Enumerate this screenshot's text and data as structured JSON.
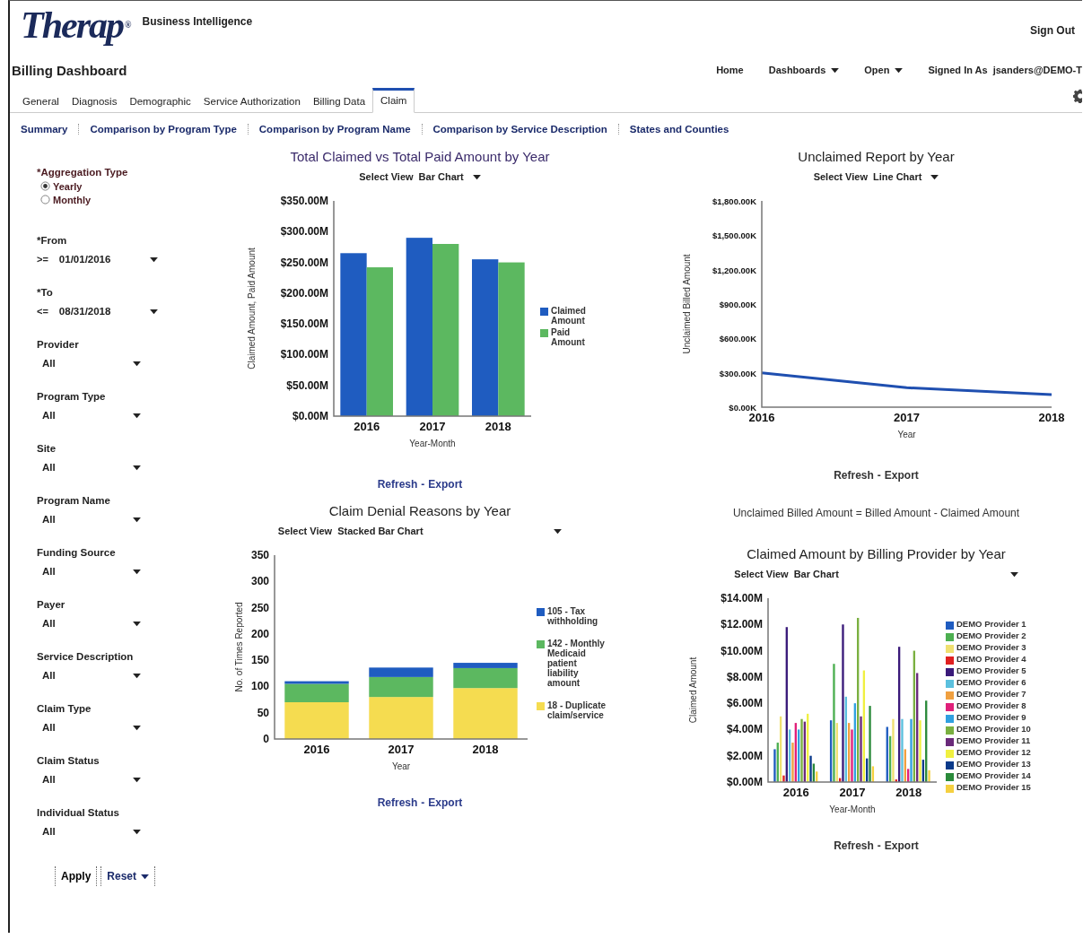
{
  "header": {
    "logo": "Therap",
    "logo_mark": "®",
    "product": "Business Intelligence",
    "sign_out": "Sign Out"
  },
  "title_bar": {
    "title": "Billing Dashboard",
    "nav": [
      {
        "label": "Home",
        "dropdown": false
      },
      {
        "label": "Dashboards",
        "dropdown": true
      },
      {
        "label": "Open",
        "dropdown": true
      }
    ],
    "signed_in_label": "Signed In As",
    "user": "jsanders@DEMO-T"
  },
  "tabs": [
    {
      "label": "General",
      "selected": false
    },
    {
      "label": "Diagnosis",
      "selected": false
    },
    {
      "label": "Demographic",
      "selected": false
    },
    {
      "label": "Service Authorization",
      "selected": false
    },
    {
      "label": "Billing Data",
      "selected": false
    },
    {
      "label": "Claim",
      "selected": true
    }
  ],
  "subtabs": [
    "Summary",
    "Comparison by Program Type",
    "Comparison by Program Name",
    "Comparison by Service Description",
    "States and Counties"
  ],
  "filters": {
    "required_mark": "*",
    "aggregation": {
      "label": "Aggregation Type",
      "required": true,
      "options": [
        {
          "label": "Yearly",
          "selected": true
        },
        {
          "label": "Monthly",
          "selected": false
        }
      ]
    },
    "fields": [
      {
        "label": "From",
        "required": true,
        "operator": ">=",
        "value": "01/01/2016"
      },
      {
        "label": "To",
        "required": true,
        "operator": "<=",
        "value": "08/31/2018"
      },
      {
        "label": "Provider",
        "required": false,
        "value": "All"
      },
      {
        "label": "Program Type",
        "required": false,
        "value": "All"
      },
      {
        "label": "Site",
        "required": false,
        "value": "All"
      },
      {
        "label": "Program Name",
        "required": false,
        "value": "All"
      },
      {
        "label": "Funding Source",
        "required": false,
        "value": "All"
      },
      {
        "label": "Payer",
        "required": false,
        "value": "All"
      },
      {
        "label": "Service Description",
        "required": false,
        "value": "All"
      },
      {
        "label": "Claim Type",
        "required": false,
        "value": "All"
      },
      {
        "label": "Claim Status",
        "required": false,
        "value": "All"
      },
      {
        "label": "Individual Status",
        "required": false,
        "value": "All"
      }
    ],
    "apply": "Apply",
    "reset": "Reset"
  },
  "charts": [
    {
      "title": "Total Claimed vs Total Paid Amount by Year",
      "view_label": "Select View",
      "view": "Bar Chart",
      "links": [
        "Refresh",
        "Export"
      ],
      "link_separator": "-",
      "chart_data": {
        "type": "bar",
        "legend": "right",
        "xlabel": "Year-Month",
        "ylabel": "Claimed Amount, Paid Amount",
        "categories": [
          "2016",
          "2017",
          "2018"
        ],
        "series": [
          {
            "name": "Claimed Amount",
            "color": "#1f5cc0",
            "values": [
              265,
              290,
              255
            ]
          },
          {
            "name": "Paid Amount",
            "color": "#5cb860",
            "values": [
              242,
              280,
              250
            ]
          }
        ],
        "ylim": [
          0,
          350
        ],
        "yticks": [
          {
            "value": 0,
            "label": "$0.00M"
          },
          {
            "value": 50,
            "label": "$50.00M"
          },
          {
            "value": 100,
            "label": "$100.00M"
          },
          {
            "value": 150,
            "label": "$150.00M"
          },
          {
            "value": 200,
            "label": "$200.00M"
          },
          {
            "value": 250,
            "label": "$250.00M"
          },
          {
            "value": 300,
            "label": "$300.00M"
          },
          {
            "value": 350,
            "label": "$350.00M"
          }
        ]
      }
    },
    {
      "title": "Unclaimed Report by Year",
      "view_label": "Select View",
      "view": "Line Chart",
      "links": [
        "Refresh",
        "Export"
      ],
      "link_separator": "-",
      "note": "Unclaimed Billed Amount = Billed Amount - Claimed Amount",
      "chart_data": {
        "type": "line",
        "xlabel": "Year",
        "ylabel": "Unclaimed Billed Amount",
        "categories": [
          "2016",
          "2017",
          "2018"
        ],
        "series": [
          {
            "color": "#1f4fb0",
            "values": [
              300,
              170,
              110
            ]
          }
        ],
        "ylim": [
          0,
          1800
        ],
        "yticks": [
          {
            "value": 0,
            "label": "$0.00K"
          },
          {
            "value": 300,
            "label": "$300.00K"
          },
          {
            "value": 600,
            "label": "$600.00K"
          },
          {
            "value": 900,
            "label": "$900.00K"
          },
          {
            "value": 1200,
            "label": "$1,200.00K"
          },
          {
            "value": 1500,
            "label": "$1,500.00K"
          },
          {
            "value": 1800,
            "label": "$1,800.00K"
          }
        ]
      }
    },
    {
      "title": "Claim Denial Reasons by Year",
      "view_label": "Select View",
      "view": "Stacked Bar Chart",
      "links": [
        "Refresh",
        "Export"
      ],
      "link_separator": "-",
      "chart_data": {
        "type": "bar",
        "legend": "right",
        "stacked": true,
        "xlabel": "Year",
        "ylabel": "No. of Times Reported",
        "categories": [
          "2016",
          "2017",
          "2018"
        ],
        "series": [
          {
            "name": "105 - Tax withholding",
            "color": "#1f5cc0",
            "values": [
              5,
              18,
              10
            ]
          },
          {
            "name": "142 - Monthly Medicaid patient liability amount",
            "color": "#5cb860",
            "values": [
              35,
              38,
              38
            ]
          },
          {
            "name": "18 - Duplicate claim/service",
            "color": "#f5dc50",
            "values": [
              70,
              80,
              97
            ]
          }
        ],
        "ylim": [
          0,
          350
        ],
        "yticks": [
          0,
          50,
          100,
          150,
          200,
          250,
          300,
          350
        ]
      }
    },
    {
      "title": "Claimed Amount by Billing Provider by Year",
      "view_label": "Select View",
      "view": "Bar Chart",
      "links": [
        "Refresh",
        "Export"
      ],
      "link_separator": "-",
      "chart_data": {
        "type": "bar",
        "legend": "right",
        "xlabel": "Year-Month",
        "ylabel": "Claimed Amount",
        "categories": [
          "2016",
          "2017",
          "2018"
        ],
        "series": [
          {
            "name": "DEMO Provider 1",
            "color": "#1f5cc0",
            "values": [
              2.5,
              4.7,
              4.2
            ]
          },
          {
            "name": "DEMO Provider 2",
            "color": "#4caf50",
            "values": [
              3.0,
              9.0,
              3.5
            ]
          },
          {
            "name": "DEMO Provider 3",
            "color": "#f0e070",
            "values": [
              5.0,
              4.5,
              4.8
            ]
          },
          {
            "name": "DEMO Provider 4",
            "color": "#e02020",
            "values": [
              0.5,
              0.3,
              0.2
            ]
          },
          {
            "name": "DEMO Provider 5",
            "color": "#3a1a7a",
            "values": [
              11.8,
              12.0,
              10.3
            ]
          },
          {
            "name": "DEMO Provider 6",
            "color": "#5bc0de",
            "values": [
              4.0,
              6.5,
              4.8
            ]
          },
          {
            "name": "DEMO Provider 7",
            "color": "#f0a040",
            "values": [
              3.0,
              4.5,
              2.5
            ]
          },
          {
            "name": "DEMO Provider 8",
            "color": "#e0207a",
            "values": [
              4.5,
              4.0,
              1.0
            ]
          },
          {
            "name": "DEMO Provider 9",
            "color": "#30a0e0",
            "values": [
              4.0,
              6.0,
              4.8
            ]
          },
          {
            "name": "DEMO Provider 10",
            "color": "#7ab040",
            "values": [
              4.8,
              12.5,
              10.0
            ]
          },
          {
            "name": "DEMO Provider 11",
            "color": "#6a2a7a",
            "values": [
              4.6,
              5.0,
              8.3
            ]
          },
          {
            "name": "DEMO Provider 12",
            "color": "#f0f040",
            "values": [
              5.2,
              8.5,
              4.7
            ]
          },
          {
            "name": "DEMO Provider 13",
            "color": "#0a3a8a",
            "values": [
              2.0,
              1.8,
              1.7
            ]
          },
          {
            "name": "DEMO Provider 14",
            "color": "#2a8a3a",
            "values": [
              1.4,
              5.8,
              6.2
            ]
          },
          {
            "name": "DEMO Provider 15",
            "color": "#f5d040",
            "values": [
              0.8,
              1.2,
              0.9
            ]
          }
        ],
        "ylim": [
          0,
          14
        ],
        "yticks": [
          {
            "value": 0,
            "label": "$0.00M"
          },
          {
            "value": 2,
            "label": "$2.00M"
          },
          {
            "value": 4,
            "label": "$4.00M"
          },
          {
            "value": 6,
            "label": "$6.00M"
          },
          {
            "value": 8,
            "label": "$8.00M"
          },
          {
            "value": 10,
            "label": "$10.00M"
          },
          {
            "value": 12,
            "label": "$12.00M"
          },
          {
            "value": 14,
            "label": "$14.00M"
          }
        ]
      }
    }
  ]
}
